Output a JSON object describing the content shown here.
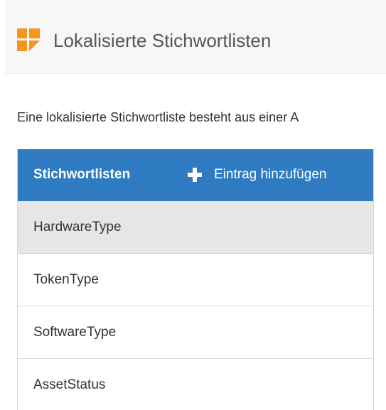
{
  "header": {
    "title": "Lokalisierte Stichwortlisten",
    "logo_colors": [
      "#f7941d",
      "#f7941d",
      "#f7941d"
    ]
  },
  "intro": {
    "text": "Eine lokalisierte Stichwortliste besteht aus einer A"
  },
  "panel": {
    "title": "Stichwortlisten",
    "add_label": "Eintrag hinzufügen",
    "accent_color": "#2f7bc2",
    "items": [
      {
        "label": "HardwareType",
        "selected": true
      },
      {
        "label": "TokenType",
        "selected": false
      },
      {
        "label": "SoftwareType",
        "selected": false
      },
      {
        "label": "AssetStatus",
        "selected": false
      }
    ]
  }
}
